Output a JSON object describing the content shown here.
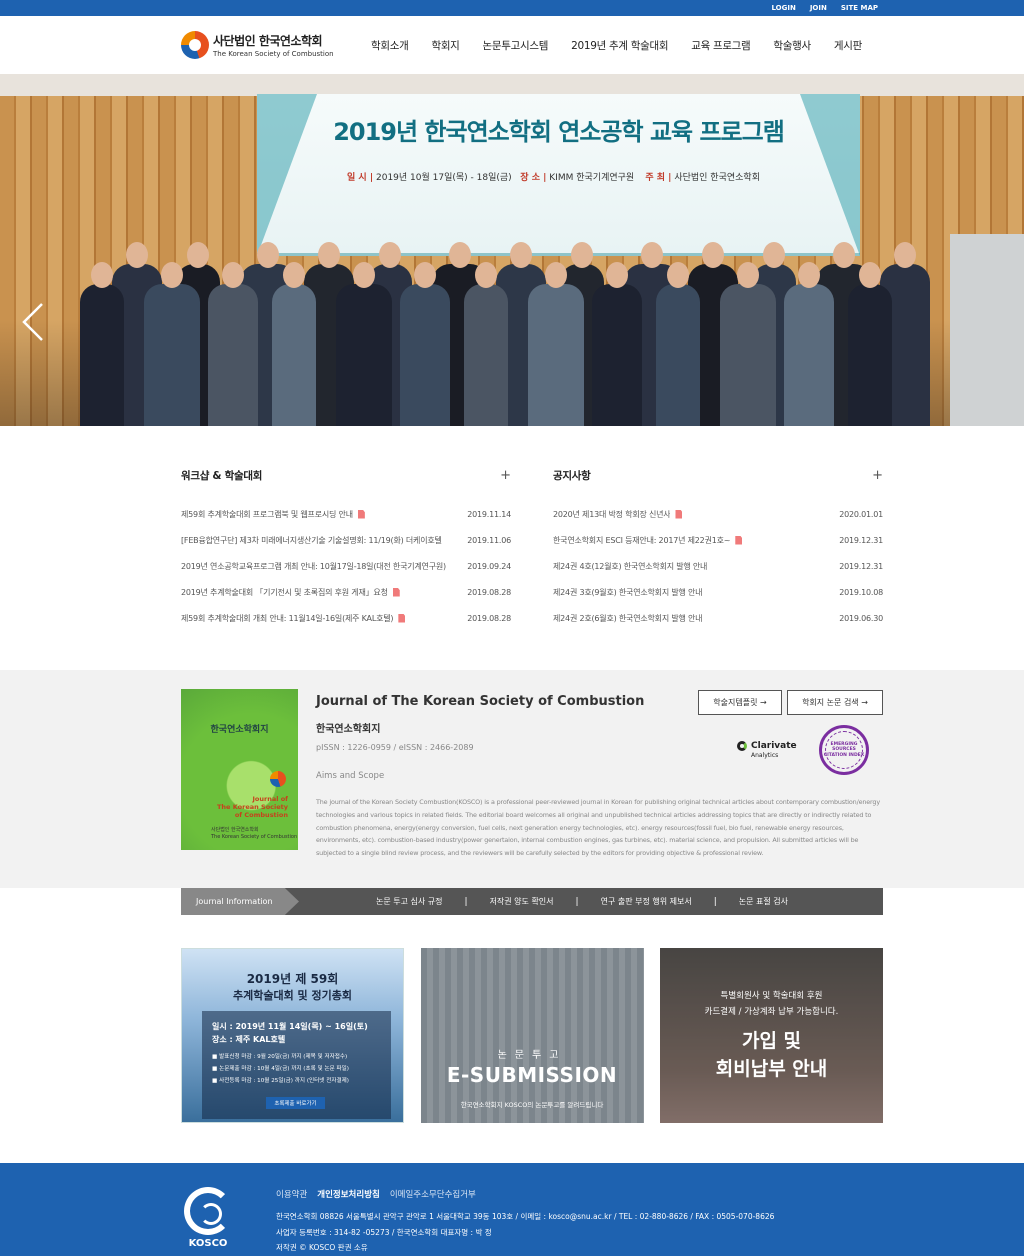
{
  "topbar": {
    "login": "LOGIN",
    "join": "JOIN",
    "sitemap": "SITE MAP"
  },
  "logo": {
    "ko": "사단법인 한국연소학회",
    "en": "The Korean Society of Combustion"
  },
  "nav": [
    "학회소개",
    "학회지",
    "논문투고시스템",
    "2019년 추계 학술대회",
    "교육 프로그램",
    "학술행사",
    "게시판"
  ],
  "hero": {
    "banner_title": "2019년 한국연소학회 연소공학 교육 프로그램",
    "banner_date_label": "일 시 |",
    "banner_date": "2019년 10월 17일(목) - 18일(금)",
    "banner_place_label": "장 소 |",
    "banner_place": "KIMM 한국기계연구원",
    "banner_host_label": "주 최 |",
    "banner_host": "사단법인 한국연소학회",
    "slides": 6,
    "active_slide": 2
  },
  "workshop": {
    "title": "워크샵 & 학술대회",
    "plus": "+",
    "rows": [
      {
        "title": "제59회 추계학술대회 프로그램북 및 웹프로시딩 안내",
        "date": "2019.11.14",
        "pdf": true
      },
      {
        "title": "[FEB융합연구단] 제3차 미래에너지생산기술 기술설명회: 11/19(화) 더케이호텔",
        "date": "2019.11.06",
        "pdf": false
      },
      {
        "title": "2019년 연소공학교육프로그램 개최 안내: 10월17일-18일(대전 한국기계연구원)",
        "date": "2019.09.24",
        "pdf": false
      },
      {
        "title": "2019년 추계학술대회 「기기전시 및 초록집의 후원 게재」요청",
        "date": "2019.08.28",
        "pdf": true
      },
      {
        "title": "제59회 추계학술대회 개최 안내: 11월14일-16일(제주 KAL호텔)",
        "date": "2019.08.28",
        "pdf": true
      }
    ]
  },
  "notice": {
    "title": "공지사항",
    "plus": "+",
    "rows": [
      {
        "title": "2020년 제13대 박정 학회장 신년사",
        "date": "2020.01.01",
        "pdf": true
      },
      {
        "title": "한국연소학회지 ESCI 등재안내: 2017년 제22권1호~",
        "date": "2019.12.31",
        "pdf": true
      },
      {
        "title": "제24권 4호(12월호) 한국연소학회지 발행 안내",
        "date": "2019.12.31",
        "pdf": false
      },
      {
        "title": "제24권 3호(9월호) 한국연소학회지 발행 안내",
        "date": "2019.10.08",
        "pdf": false
      },
      {
        "title": "제24권 2호(6월호) 한국연소학회지 발행 안내",
        "date": "2019.06.30",
        "pdf": false
      }
    ]
  },
  "journal": {
    "cover_title": "한국연소학회지",
    "cover_en": "Journal of\nThe Korean Society\nof Combustion",
    "cover_pub": "사단법인 한국연소학회\nThe Korean Society of Combustion",
    "title": "Journal of The Korean Society of Combustion",
    "ko": "한국연소학회지",
    "issn": "pISSN : 1226-0959 / eISSN : 2466-2089",
    "aims": "Aims and Scope",
    "desc": "The journal of the Korean Society Combustion(KOSCO) is a professional peer-reviewed journal in Korean for publishing original technical articles about contemporary combustion/energy technologies and various topics in related fields. The editorial board welcomes all original and unpublished technical articles addressing topics that are directly or indirectly related to combustion phenomena, energy(energy conversion, fuel cells, next generation energy technologies, etc). energy resources(fossil fuel, bio fuel, renewable energy resources, environments, etc). combustion-based industry(power genertaion, internal combustion engines, gas turbines, etc). material science, and propulsion. All submitted articles will be subjected to a single blind review process, and the reviewers will be carefully selected by the editors for providing objective & professional review.",
    "btn_template": "학술지템플릿 →",
    "btn_search": "학회지 논문 검색 →",
    "clarivate": "Clarivate",
    "clarivate_sub": "Analytics",
    "esci": "EMERGING SOURCES CITATION INDEX"
  },
  "infobar": {
    "label": "Journal Information",
    "links": [
      "논문 투고 심사 규정",
      "저작권 양도 확인서",
      "연구 출판 부정 행위 제보서",
      "논문 표절 검사"
    ]
  },
  "cards": {
    "conf": {
      "h1": "2019년 제 59회",
      "h2": "추계학술대회 및 정기총회",
      "date": "일시 : 2019년 11월 14일(목) ~ 16일(토)",
      "place": "장소 : 제주 KAL호텔",
      "s1": "■ 발표신청 마감 : 9월 20일(금) 까지 (제목 및 저자접수)",
      "s2": "■ 논문제출 마감 : 10월 4일(금) 까지 (초록 및 논문 파일)",
      "s3": "■ 사전등록 마감 : 10월 25일(금) 까지 (인터넷 전자결제)",
      "btn": "초록제출 바로가기"
    },
    "submission": {
      "k": "논문투고",
      "e": "E-SUBMISSION",
      "f": "한국연소학회지 KOSCO의 논문투고를 알려드립니다"
    },
    "member": {
      "a": "특별회원사 및 학술대회 후원",
      "b": "카드결제 / 가상계좌 납부 가능합니다.",
      "c": "가입 및",
      "d": "회비납부 안내"
    }
  },
  "footer": {
    "logo": "KOSCO",
    "links": [
      "이용약관",
      "개인정보처리방침",
      "이메일주소무단수집거부"
    ],
    "line1": "한국연소학회 08826 서울특별시 관악구 관악로 1 서울대학교 39동 103호 / 이메일 : kosco@snu.ac.kr / TEL : 02-880-8626 / FAX : 0505-070-8626",
    "line2": "사업자 등록번호 : 314-82 -05273 / 한국연소학회 대표자명 : 박 정",
    "line3": "저작권 © KOSCO 판권 소유"
  }
}
